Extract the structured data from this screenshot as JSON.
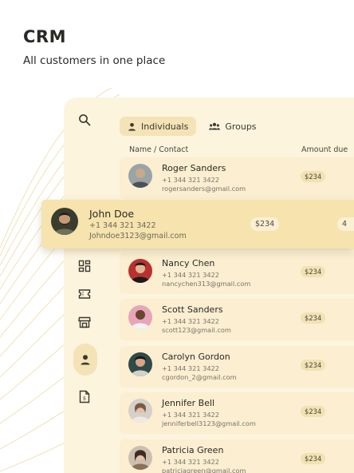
{
  "header": {
    "title": "CRM",
    "subtitle": "All customers in one place"
  },
  "tabs": [
    {
      "label": "Individuals",
      "icon": "person-icon",
      "active": true
    },
    {
      "label": "Groups",
      "icon": "group-icon",
      "active": false
    }
  ],
  "columns": {
    "name_contact": "Name / Contact",
    "amount_due": "Amount due"
  },
  "focused_contact": {
    "name": "John Doe",
    "phone": "+1 344 321 3422",
    "email": "Johndoe3123@gmail.com",
    "amount": "$234",
    "extra": "4"
  },
  "contacts": [
    {
      "name": "Roger Sanders",
      "phone": "+1 344 321 3422",
      "email": "rogersanders@gmail.com",
      "amount": "$234"
    },
    {
      "name": "Nancy Chen",
      "phone": "+1 344 321 3422",
      "email": "nancychen313@gmail.com",
      "amount": "$234"
    },
    {
      "name": "Scott Sanders",
      "phone": "+1 344 321 3422",
      "email": "scott123@gmail.com",
      "amount": "$234"
    },
    {
      "name": "Carolyn Gordon",
      "phone": "+1 344 321 3422",
      "email": "cgordon_2@gmail.com",
      "amount": "$234"
    },
    {
      "name": "Jennifer Bell",
      "phone": "+1 344 321 3422",
      "email": "jenniferbell3123@gmail.com",
      "amount": "$234"
    },
    {
      "name": "Patricia Green",
      "phone": "+1 344 321 3422",
      "email": "patriciagreen@gmail.com",
      "amount": "$234"
    }
  ],
  "sidebar": {
    "items": [
      {
        "icon": "search-icon"
      },
      {
        "icon": "dashboard-icon"
      },
      {
        "icon": "ticket-icon"
      },
      {
        "icon": "store-icon"
      },
      {
        "icon": "person-icon",
        "active": true
      },
      {
        "icon": "document-icon"
      }
    ]
  },
  "colors": {
    "panel": "#fcf4dd",
    "card": "#fbeed1",
    "accent": "#f3e3b6",
    "focus_card": "#f6e3ae"
  }
}
